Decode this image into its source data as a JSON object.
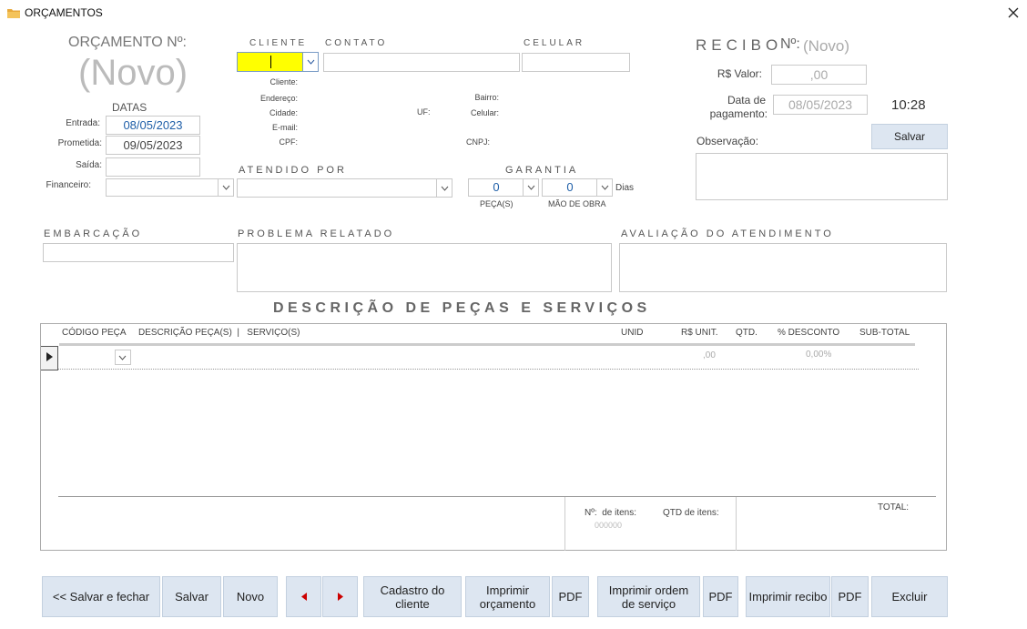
{
  "window": {
    "title": "ORÇAMENTOS"
  },
  "orcamento": {
    "label": "ORÇAMENTO Nº:",
    "number": "(Novo)"
  },
  "datas": {
    "title": "DATAS",
    "entrada_label": "Entrada:",
    "entrada_value": "08/05/2023",
    "prometida_label": "Prometida:",
    "prometida_value": "09/05/2023",
    "saida_label": "Saída:",
    "saida_value": "",
    "financeiro_label": "Financeiro:"
  },
  "cliente": {
    "cliente_header": "CLIENTE",
    "contato_header": "CONTATO",
    "celular_header": "CELULAR",
    "info_cliente": "Cliente:",
    "info_endereco": "Endereço:",
    "info_cidade": "Cidade:",
    "info_email": "E-mail:",
    "info_cpf": "CPF:",
    "info_uf": "UF:",
    "info_bairro": "Bairro:",
    "info_celular": "Celular:",
    "info_cnpj": "CNPJ:"
  },
  "atendido_por": {
    "label": "ATENDIDO POR"
  },
  "garantia": {
    "label": "GARANTIA",
    "pecas_value": "0",
    "pecas_label": "PEÇA(S)",
    "mao_value": "0",
    "mao_label": "MÃO DE OBRA",
    "dias": "Dias"
  },
  "recibo": {
    "title": "RECIBO",
    "no_label": "Nº:",
    "number": "(Novo)",
    "valor_label": "R$ Valor:",
    "valor_value": ",00",
    "data_label_1": "Data de",
    "data_label_2": "pagamento:",
    "data_value": "08/05/2023",
    "time": "10:28",
    "obs_label": "Observação:",
    "save_label": "Salvar"
  },
  "sections": {
    "embarcacao": "EMBARCAÇÃO",
    "problema": "PROBLEMA RELATADO",
    "avaliacao": "AVALIAÇÃO DO ATENDIMENTO",
    "descricao": "DESCRIÇÃO DE PEÇAS E SERVIÇOS"
  },
  "grid": {
    "headers": {
      "codigo": "CÓDIGO PEÇA",
      "descricao": "DESCRIÇÃO PEÇA(S)  |   SERVIÇO(S)",
      "unid": "UNID",
      "unit": "R$ UNIT.",
      "qtd": "QTD.",
      "desconto": "% DESCONTO",
      "subtotal": "SUB-TOTAL"
    },
    "row": {
      "unit": ",00",
      "desconto": "0,00%"
    },
    "footer": {
      "nitens_label": "Nº:  de itens:",
      "nitens_value": "000000",
      "qtd_label": "QTD de itens:",
      "total_label": "TOTAL:"
    }
  },
  "buttons": {
    "salvar_fechar": "<< Salvar e fechar",
    "salvar": "Salvar",
    "novo": "Novo",
    "cadastro": "Cadastro do cliente",
    "imprimir_orc": "Imprimir orçamento",
    "pdf1": "PDF",
    "imprimir_os": "Imprimir ordem de serviço",
    "pdf2": "PDF",
    "imprimir_recibo": "Imprimir recibo",
    "pdf3": "PDF",
    "excluir": "Excluir"
  }
}
